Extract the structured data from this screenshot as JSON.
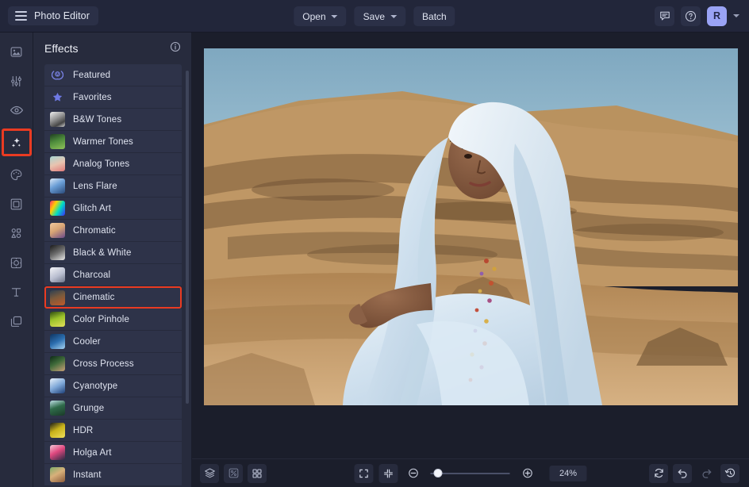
{
  "app": {
    "title": "Photo Editor",
    "accent_purple": "#9aa3f5",
    "highlight_red": "#ea3b22",
    "panel_bg": "#272b3d",
    "row_bg": "#2e3349",
    "canvas_bg": "#1b1e2b"
  },
  "topbar": {
    "menu_icon": "hamburger-icon",
    "buttons": [
      {
        "label": "Open",
        "has_caret": true
      },
      {
        "label": "Save",
        "has_caret": true
      },
      {
        "label": "Batch",
        "has_caret": false
      }
    ],
    "right_icons": [
      {
        "name": "feedback-icon"
      },
      {
        "name": "help-icon"
      }
    ],
    "avatar": {
      "initial": "R",
      "color": "#9aa3f5"
    },
    "avatar_caret": "chevron-down-icon"
  },
  "rail": {
    "items": [
      {
        "name": "image-icon",
        "label": "Image",
        "active": false
      },
      {
        "name": "adjust-sliders-icon",
        "label": "Adjust",
        "active": false
      },
      {
        "name": "eye-icon",
        "label": "Preview",
        "active": false
      },
      {
        "name": "sparkles-icon",
        "label": "Effects",
        "active": true
      },
      {
        "name": "palette-icon",
        "label": "Paint",
        "active": false
      },
      {
        "name": "frame-icon",
        "label": "Frames",
        "active": false
      },
      {
        "name": "shapes-icon",
        "label": "Shapes",
        "active": false
      },
      {
        "name": "sticker-icon",
        "label": "Stickers",
        "active": false
      },
      {
        "name": "text-icon",
        "label": "Text",
        "active": false
      },
      {
        "name": "layers-icon",
        "label": "Layers",
        "active": false
      }
    ]
  },
  "panel": {
    "title": "Effects",
    "info_icon": "info-icon",
    "items": [
      {
        "label": "Featured",
        "icon": "featured-badge-icon",
        "thumb": "none",
        "selected": false
      },
      {
        "label": "Favorites",
        "icon": "star-icon",
        "thumb": "none",
        "selected": false
      },
      {
        "label": "B&W Tones",
        "icon": "",
        "thumb": "bw-face",
        "selected": false
      },
      {
        "label": "Warmer Tones",
        "icon": "",
        "thumb": "green-leaf",
        "selected": false
      },
      {
        "label": "Analog Tones",
        "icon": "",
        "thumb": "flamingo",
        "selected": false
      },
      {
        "label": "Lens Flare",
        "icon": "",
        "thumb": "blue-flare",
        "selected": false
      },
      {
        "label": "Glitch Art",
        "icon": "",
        "thumb": "glitch",
        "selected": false
      },
      {
        "label": "Chromatic",
        "icon": "",
        "thumb": "chromatic",
        "selected": false
      },
      {
        "label": "Black & White",
        "icon": "",
        "thumb": "bw-swirl",
        "selected": false
      },
      {
        "label": "Charcoal",
        "icon": "",
        "thumb": "charcoal",
        "selected": false
      },
      {
        "label": "Cinematic",
        "icon": "",
        "thumb": "cinematic",
        "selected": true
      },
      {
        "label": "Color Pinhole",
        "icon": "",
        "thumb": "pinhole",
        "selected": false
      },
      {
        "label": "Cooler",
        "icon": "",
        "thumb": "cooler",
        "selected": false
      },
      {
        "label": "Cross Process",
        "icon": "",
        "thumb": "cross-process",
        "selected": false
      },
      {
        "label": "Cyanotype",
        "icon": "",
        "thumb": "cyanotype",
        "selected": false
      },
      {
        "label": "Grunge",
        "icon": "",
        "thumb": "grunge",
        "selected": false
      },
      {
        "label": "HDR",
        "icon": "",
        "thumb": "hdr",
        "selected": false
      },
      {
        "label": "Holga Art",
        "icon": "",
        "thumb": "holga",
        "selected": false
      },
      {
        "label": "Instant",
        "icon": "",
        "thumb": "instant",
        "selected": false
      }
    ]
  },
  "canvas": {
    "image_alt": "Woman in light blue headscarf standing in a desert landscape"
  },
  "bottombar": {
    "left_icons": [
      {
        "name": "layers-stack-icon"
      },
      {
        "name": "compare-toggle-icon"
      },
      {
        "name": "grid-view-icon"
      }
    ],
    "center_icons": [
      {
        "name": "fit-to-screen-icon"
      },
      {
        "name": "shrink-to-fit-icon"
      },
      {
        "name": "zoom-out-icon"
      },
      {
        "name": "zoom-in-icon"
      }
    ],
    "zoom_level": "24%",
    "slider_position_pct": 4,
    "right_icons": [
      {
        "name": "reset-icon",
        "disabled": false
      },
      {
        "name": "undo-icon",
        "disabled": false
      },
      {
        "name": "redo-icon",
        "disabled": true
      },
      {
        "name": "history-icon",
        "disabled": false
      }
    ]
  }
}
